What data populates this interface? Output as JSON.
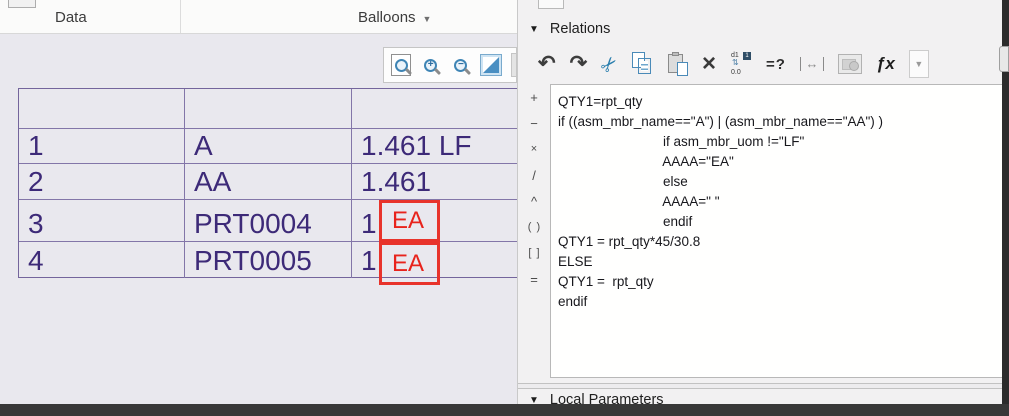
{
  "ribbon": {
    "data_group_label": "Data",
    "balloons_group_label": "Balloons",
    "balloons_arrow": "▼"
  },
  "zoom_toolbar": {
    "icons": [
      {
        "name": "zoom-region-icon",
        "desc": "magnifier in box"
      },
      {
        "name": "zoom-in-icon",
        "glyph": "+"
      },
      {
        "name": "zoom-out-icon",
        "glyph": "−"
      },
      {
        "name": "update-view-icon",
        "desc": "diagonal split square, selected"
      }
    ]
  },
  "bom_table": {
    "rows": [
      {
        "no": "1",
        "name": "A",
        "qty": "1.461 LF",
        "uom_red": ""
      },
      {
        "no": "2",
        "name": "AA",
        "qty": "1.461",
        "uom_red": ""
      },
      {
        "no": "3",
        "name": "PRT0004",
        "qty": "1",
        "uom_red": "EA"
      },
      {
        "no": "4",
        "name": "PRT0005",
        "qty": "1",
        "uom_red": "EA"
      }
    ]
  },
  "annotations": {
    "highlight_color": "#e8332b",
    "ea_1": "EA",
    "ea_2": "EA"
  },
  "relations": {
    "title": "Relations",
    "collapse_arrow": "▼",
    "toolbar_icons": {
      "undo_glyph": "↶",
      "redo_glyph": "↷",
      "cut_glyph": "✂",
      "delete_glyph": "×",
      "switch_dims_top": "d1",
      "switch_dims_arrows": "⇅",
      "switch_dims_bottom": "0.0",
      "switch_dims_badge": "1",
      "verify_label": "=?",
      "units_glyph": "↔",
      "fx_label": "ƒx",
      "dropdown_arrow": "▼"
    },
    "operators": [
      "+",
      "−",
      "×",
      "/",
      "^",
      "( )",
      "[ ]",
      "="
    ],
    "code_lines": [
      "QTY1=rpt_qty",
      "",
      "if ((asm_mbr_name==\"A\") | (asm_mbr_name==\"AA\") )",
      "                            if asm_mbr_uom !=\"LF\"",
      "                            AAAA=\"EA\"",
      "                            else",
      "                            AAAA=\" \"",
      "                            endif",
      "QTY1 = rpt_qty*45/30.8",
      "ELSE",
      "QTY1 =  rpt_qty",
      "endif"
    ]
  },
  "local_parameters": {
    "title": "Local Parameters",
    "collapse_arrow": "▼"
  },
  "colors": {
    "table_text": "#3d2a78",
    "table_border": "#74659c",
    "annotation_red": "#e8332b",
    "left_pane_bg": "#e9e8ee",
    "panel_bg": "#f2f1f2",
    "code_text": "#17171c"
  }
}
